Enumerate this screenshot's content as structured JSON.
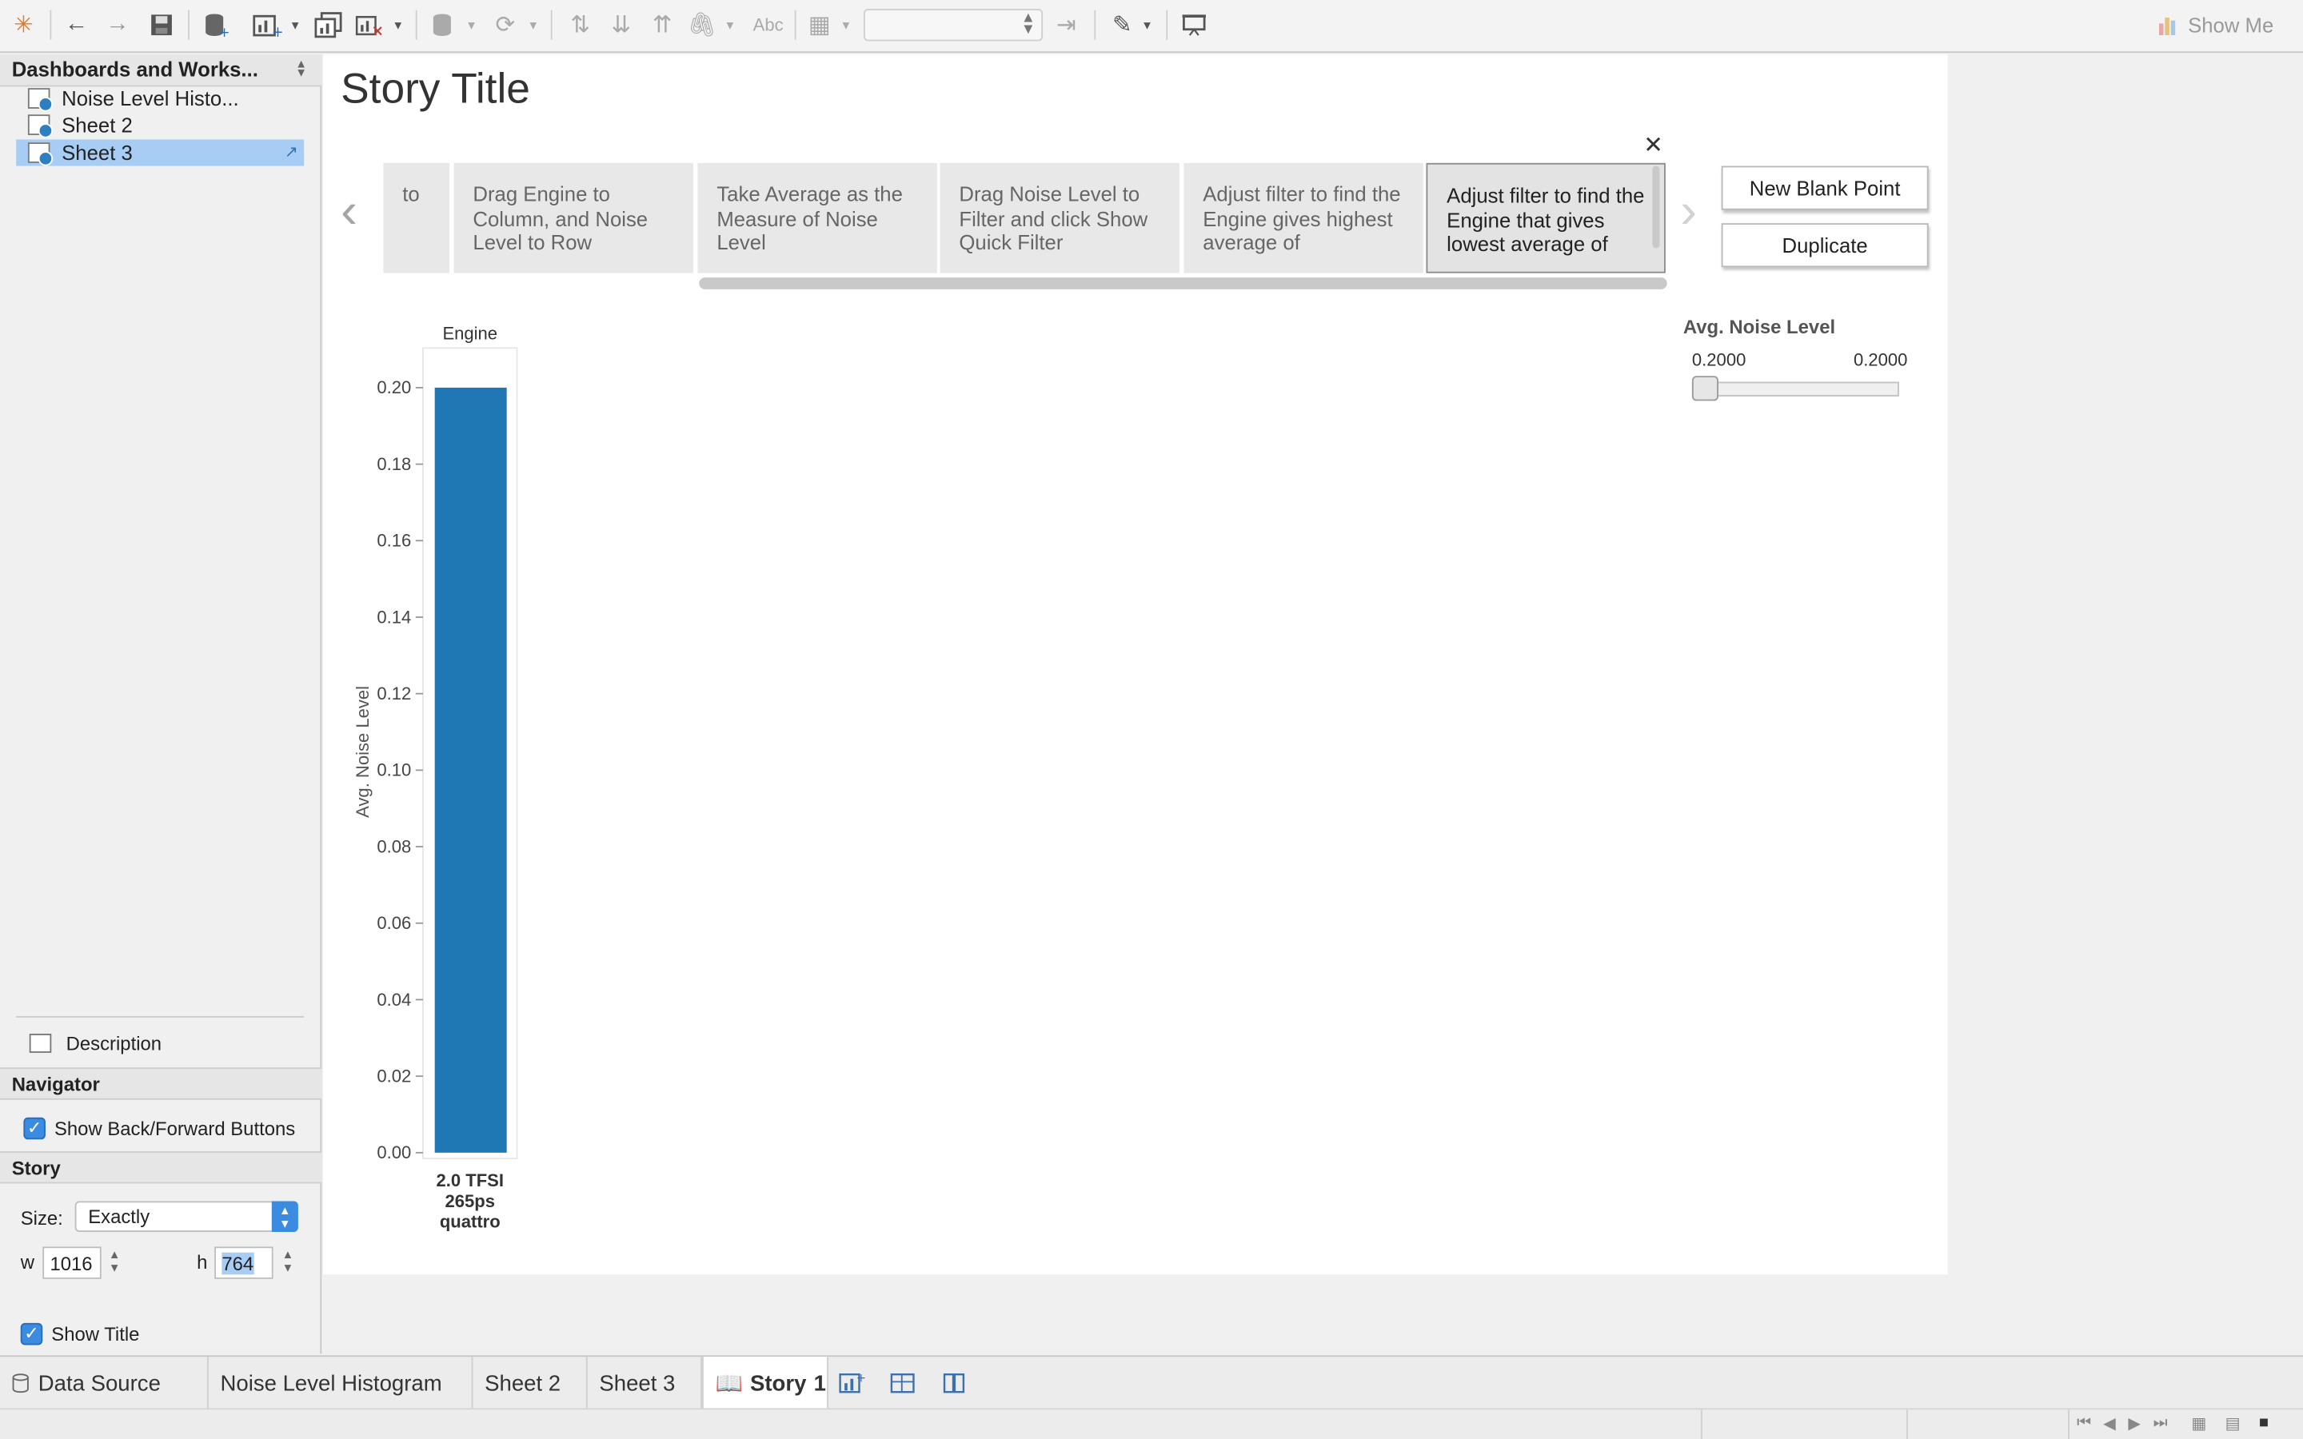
{
  "toolbar": {
    "format_placeholder": "Abc",
    "show_me_label": "Show Me",
    "fit_value": ""
  },
  "left_panel": {
    "header": "Dashboards and Works...",
    "sheets": [
      {
        "label": "Noise Level Histo...",
        "selected": false
      },
      {
        "label": "Sheet 2",
        "selected": false
      },
      {
        "label": "Sheet 3",
        "selected": true
      }
    ],
    "description_label": "Description",
    "navigator_header": "Navigator",
    "show_back_forward_label": "Show Back/Forward Buttons",
    "story_header": "Story",
    "size_label": "Size:",
    "size_value": "Exactly",
    "width_label": "w",
    "width_value": "1016",
    "height_label": "h",
    "height_value": "764",
    "show_title_label": "Show Title"
  },
  "story": {
    "title": "Story Title",
    "points": [
      "to",
      "Drag Engine to Column, and Noise Level to Row",
      "Take Average as the Measure of Noise Level",
      "Drag Noise Level to Filter and click Show Quick Filter",
      "Adjust filter to find the Engine gives highest average of",
      "Adjust filter to find the Engine that gives lowest average of"
    ],
    "active_point": 5,
    "new_blank_point_label": "New Blank Point",
    "duplicate_label": "Duplicate"
  },
  "filter": {
    "title": "Avg. Noise Level",
    "min_label": "0.2000",
    "max_label": "0.2000"
  },
  "chart_data": {
    "type": "bar",
    "column_header": "Engine",
    "categories": [
      "2.0 TFSI 265ps quattro"
    ],
    "category_lines": [
      "2.0 TFSI",
      "265ps",
      "quattro"
    ],
    "values": [
      0.2
    ],
    "ylabel": "Avg. Noise Level",
    "ylim": [
      0,
      0.2
    ],
    "yticks": [
      "0.20",
      "0.18",
      "0.16",
      "0.14",
      "0.12",
      "0.10",
      "0.08",
      "0.06",
      "0.04",
      "0.02",
      "0.00"
    ],
    "bar_color": "#1f77b4"
  },
  "tabs": {
    "data_source": "Data Source",
    "sheets": [
      "Noise Level Histogram",
      "Sheet 2",
      "Sheet 3"
    ],
    "story_prefix": "Story",
    "story_number": "1"
  }
}
